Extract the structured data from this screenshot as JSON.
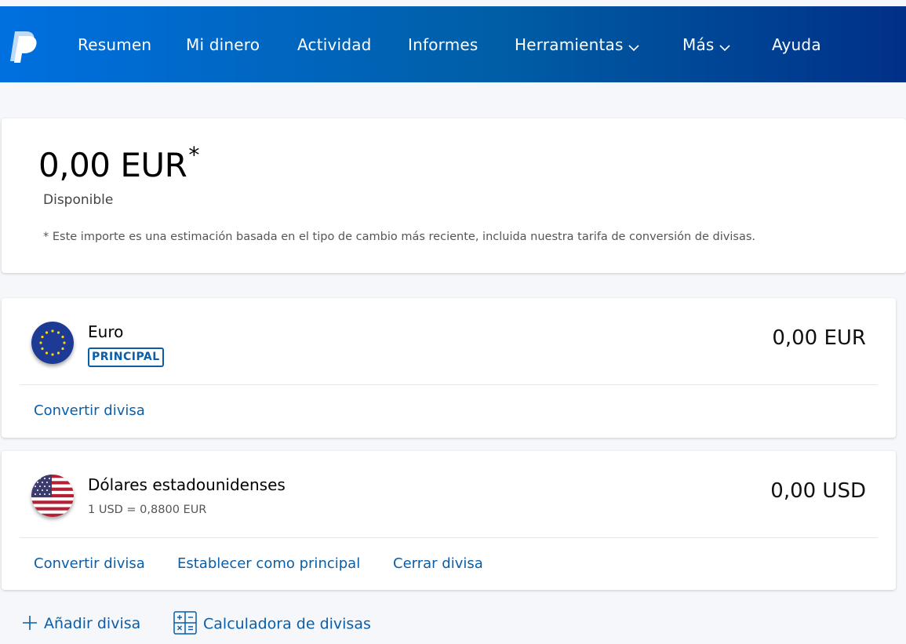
{
  "nav": {
    "items": [
      {
        "label": "Resumen"
      },
      {
        "label": "Mi dinero"
      },
      {
        "label": "Actividad"
      },
      {
        "label": "Informes"
      },
      {
        "label": "Herramientas"
      },
      {
        "label": "Más"
      },
      {
        "label": "Ayuda"
      }
    ]
  },
  "balance": {
    "amount": "0,00 EUR",
    "asterisk": "*",
    "label": "Disponible",
    "note": "* Este importe es una estimación basada en el tipo de cambio más reciente, incluida nuestra tarifa de conversión de divisas."
  },
  "currencies": [
    {
      "name": "Euro",
      "badge": "PRINCIPAL",
      "amount": "0,00 EUR",
      "actions": [
        "Convertir divisa"
      ]
    },
    {
      "name": "Dólares estadounidenses",
      "rate": "1 USD = 0,8800 EUR",
      "amount": "0,00 USD",
      "actions": [
        "Convertir divisa",
        "Establecer como principal",
        "Cerrar divisa"
      ]
    }
  ],
  "footer": {
    "add_currency": "Añadir divisa",
    "calculator": "Calculadora de divisas"
  },
  "colors": {
    "brand_blue": "#0070e0",
    "brand_dark": "#003087",
    "link": "#0a5ea8"
  }
}
